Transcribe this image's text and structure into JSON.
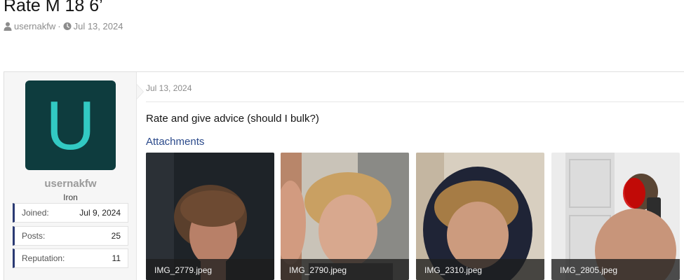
{
  "thread": {
    "title": "Rate M 18 6’",
    "author": "usernakfw",
    "separator": "·",
    "date": "Jul 13, 2024",
    "icons": {
      "author": "user-icon",
      "date": "clock-icon"
    }
  },
  "user": {
    "avatar_letter": "U",
    "name": "usernakfw",
    "rank": "Iron",
    "stats": [
      {
        "label": "Joined:",
        "value": "Jul 9, 2024"
      },
      {
        "label": "Posts:",
        "value": "25"
      },
      {
        "label": "Reputation:",
        "value": "11"
      }
    ]
  },
  "post": {
    "date": "Jul 13, 2024",
    "body": "Rate and give advice (should I bulk?)",
    "attachments_label": "Attachments",
    "attachments": [
      {
        "filename": "IMG_2779.jpeg"
      },
      {
        "filename": "IMG_2790.jpeg"
      },
      {
        "filename": "IMG_2310.jpeg"
      },
      {
        "filename": "IMG_2805.jpeg"
      }
    ]
  },
  "colors": {
    "avatar_bg": "#0e3c3e",
    "avatar_letter": "#32c9c3",
    "accent": "#2b3a73",
    "link": "#2b4a8b"
  }
}
